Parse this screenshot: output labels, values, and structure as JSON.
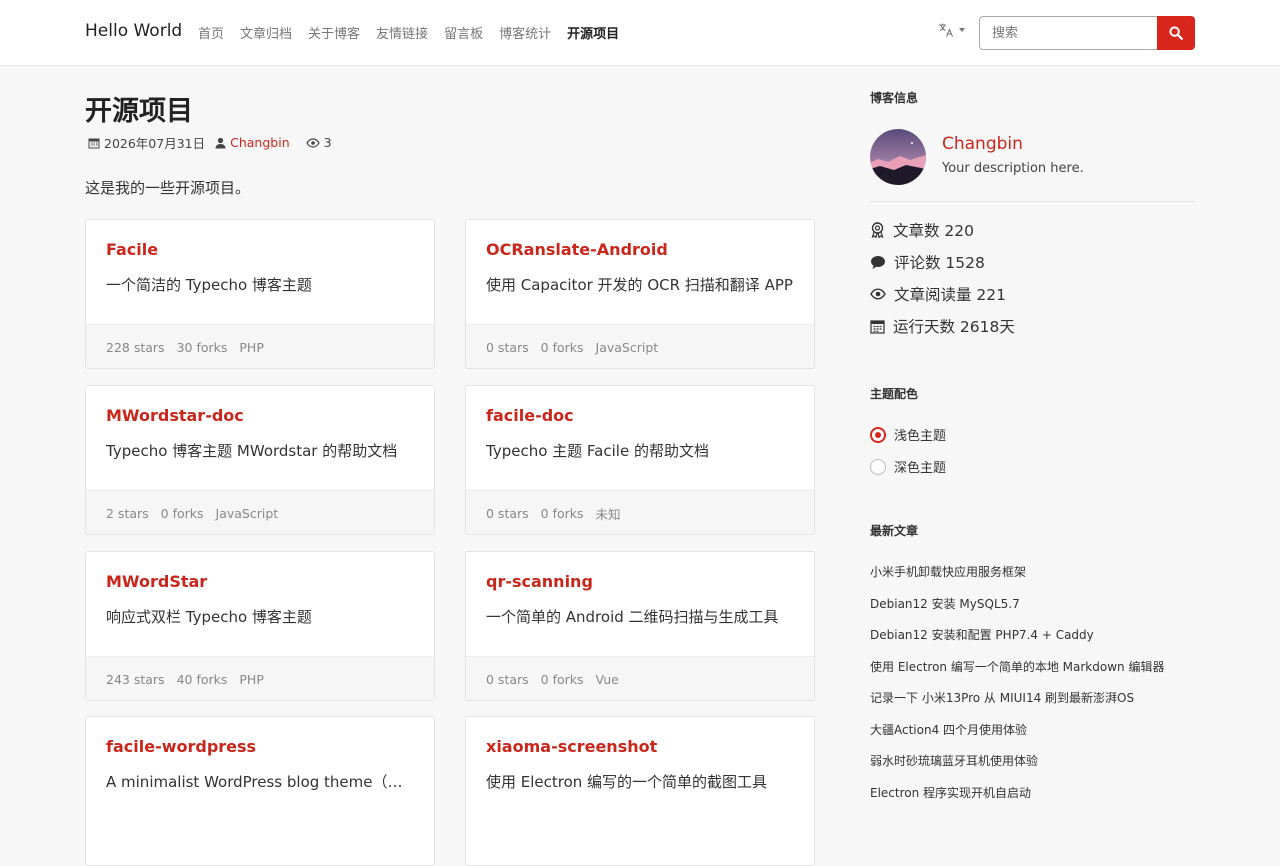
{
  "header": {
    "brand": "Hello World",
    "nav": [
      {
        "label": "首页",
        "active": false
      },
      {
        "label": "文章归档",
        "active": false
      },
      {
        "label": "关于博客",
        "active": false
      },
      {
        "label": "友情链接",
        "active": false
      },
      {
        "label": "留言板",
        "active": false
      },
      {
        "label": "博客统计",
        "active": false
      },
      {
        "label": "开源项目",
        "active": true
      }
    ],
    "search_placeholder": "搜索"
  },
  "page": {
    "title": "开源项目",
    "date": "2026年07月31日",
    "author": "Changbin",
    "views": "3",
    "intro": "这是我的一些开源项目。"
  },
  "projects": [
    {
      "name": "Facile",
      "description": "一个简洁的 Typecho 博客主题",
      "stars": "228 stars",
      "forks": "30 forks",
      "language": "PHP"
    },
    {
      "name": "OCRanslate-Android",
      "description": "使用 Capacitor 开发的 OCR 扫描和翻译 APP",
      "stars": "0 stars",
      "forks": "0 forks",
      "language": "JavaScript"
    },
    {
      "name": "MWordstar-doc",
      "description": "Typecho 博客主题 MWordstar 的帮助文档",
      "stars": "2 stars",
      "forks": "0 forks",
      "language": "JavaScript"
    },
    {
      "name": "facile-doc",
      "description": "Typecho 主题 Facile 的帮助文档",
      "stars": "0 stars",
      "forks": "0 forks",
      "language": "未知"
    },
    {
      "name": "MWordStar",
      "description": "响应式双栏 Typecho 博客主题",
      "stars": "243 stars",
      "forks": "40 forks",
      "language": "PHP"
    },
    {
      "name": "qr-scanning",
      "description": "一个简单的 Android 二维码扫描与生成工具",
      "stars": "0 stars",
      "forks": "0 forks",
      "language": "Vue"
    },
    {
      "name": "facile-wordpress",
      "description": "A minimalist WordPress blog theme（简约的 WordPress 博客主题）",
      "stars": "",
      "forks": "",
      "language": ""
    },
    {
      "name": "xiaoma-screenshot",
      "description": "使用 Electron 编写的一个简单的截图工具",
      "stars": "",
      "forks": "",
      "language": ""
    }
  ],
  "sidebar": {
    "blog_info_heading": "博客信息",
    "author_name": "Changbin",
    "author_desc": "Your description here.",
    "stats": [
      {
        "icon": "award-icon",
        "label": "文章数 220"
      },
      {
        "icon": "comment-icon",
        "label": "评论数 1528"
      },
      {
        "icon": "eye-icon",
        "label": "文章阅读量 221"
      },
      {
        "icon": "calendar-icon",
        "label": "运行天数 2618天"
      }
    ],
    "theme_heading": "主题配色",
    "theme_options": [
      {
        "label": "浅色主题",
        "checked": true
      },
      {
        "label": "深色主题",
        "checked": false
      }
    ],
    "recent_heading": "最新文章",
    "recent_posts": [
      "小米手机卸载快应用服务框架",
      "Debian12 安装 MySQL5.7",
      "Debian12 安装和配置 PHP7.4 + Caddy",
      "使用 Electron 编写一个简单的本地 Markdown 编辑器",
      "记录一下 小米13Pro 从 MIUI14 刷到最新澎湃OS",
      "大疆Action4 四个月使用体验",
      "弱水时砂琉璃蓝牙耳机使用体验",
      "Electron 程序实现开机自启动"
    ]
  },
  "colors": {
    "accent": "#d9261c",
    "link": "#c9261c"
  }
}
